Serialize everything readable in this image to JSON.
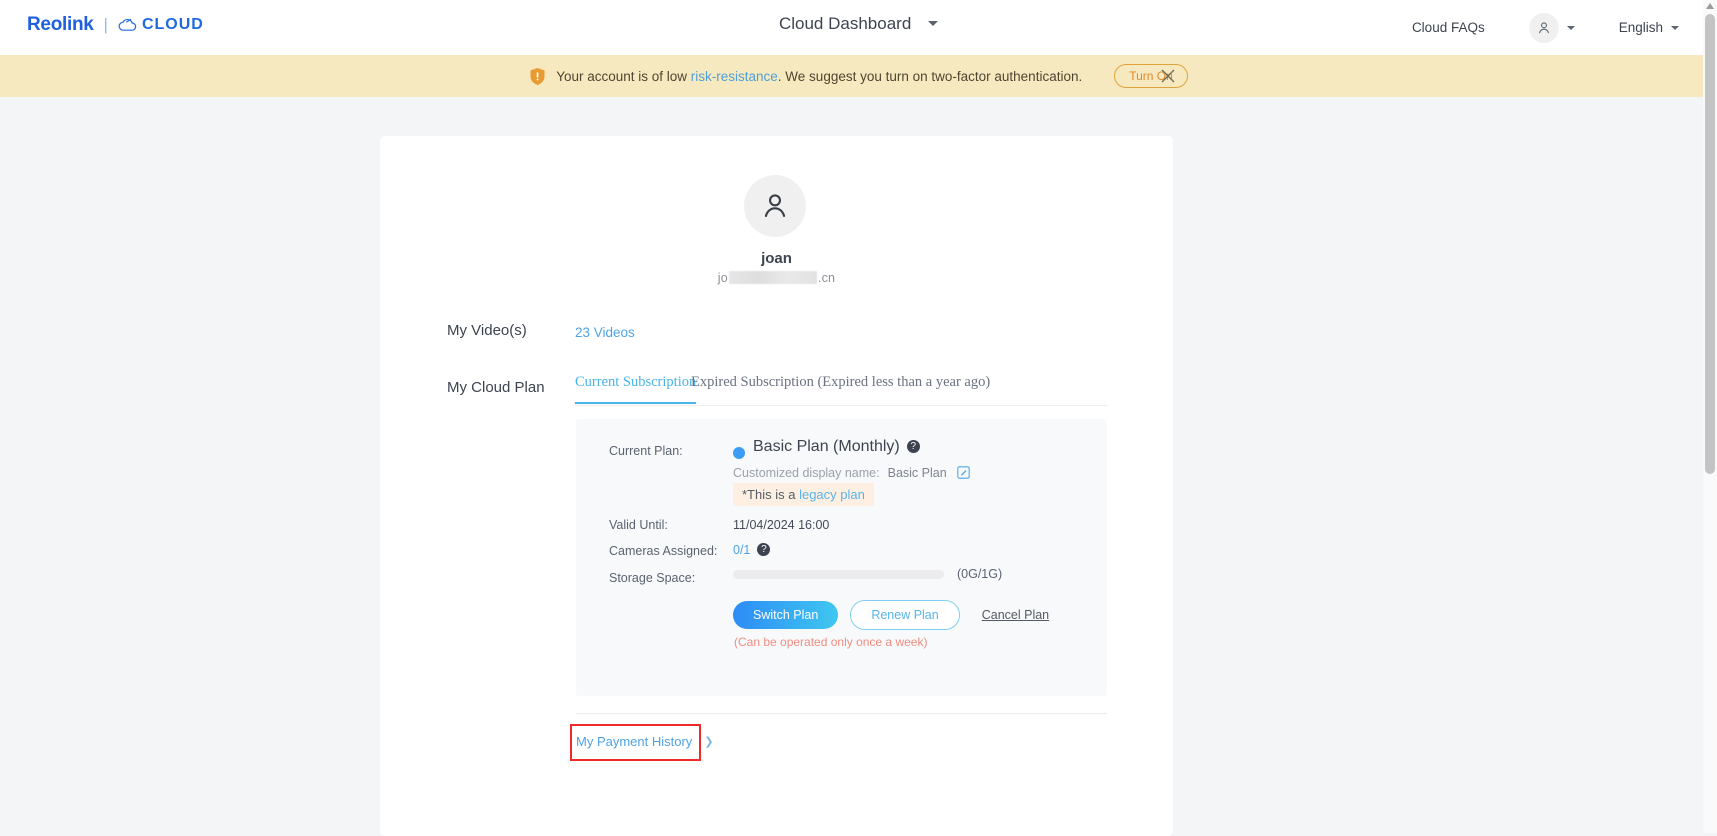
{
  "header": {
    "brand_name": "Reolink",
    "brand_separator": "|",
    "brand_cloud": "CLOUD",
    "title": "Cloud Dashboard",
    "faq_label": "Cloud FAQs",
    "language": "English",
    "avatar_icon": "user-icon",
    "title_caret_icon": "chevron-down-icon",
    "avatar_caret_icon": "chevron-down-icon",
    "language_caret_icon": "chevron-down-icon"
  },
  "notice": {
    "icon": "shield-warning-icon",
    "text_before": "Your account is of low ",
    "link_text": "risk-resistance",
    "text_after": ". We suggest you turn on two-factor authentication.",
    "button_label": "Turn On",
    "close_icon": "close-icon",
    "bg_color": "#f7e9bf",
    "link_color": "#4f9fd8",
    "button_color": "#e08a2c"
  },
  "profile": {
    "avatar_icon": "user-icon",
    "name": "joan",
    "email_prefix": "jo",
    "email_suffix": ".cn",
    "email_redacted": true
  },
  "videos": {
    "label": "My Video(s)",
    "count_label": "23 Videos",
    "link_color": "#4fa3e3"
  },
  "cloud_plan": {
    "label": "My Cloud Plan",
    "tabs": [
      {
        "label": "Current Subscription",
        "active": true
      },
      {
        "label": "Expired Subscription (Expired less than a year ago)",
        "active": false
      }
    ],
    "active_tab_color": "#4ab3e8",
    "fields": {
      "current_plan_label": "Current Plan:",
      "current_plan_value": "Basic Plan (Monthly)",
      "plan_dot_color": "#3b9bf5",
      "plan_help_icon": "question-mark-icon",
      "customized_name_label": "Customized display name:",
      "customized_name_value": "Basic Plan",
      "edit_icon": "edit-pencil-icon",
      "legacy_prefix": "*This is a ",
      "legacy_link": "legacy plan",
      "valid_until_label": "Valid Until:",
      "valid_until_value": "11/04/2024 16:00",
      "cameras_label": "Cameras Assigned:",
      "cameras_value": "0/1",
      "cameras_help_icon": "question-mark-icon",
      "storage_label": "Storage Space:",
      "storage_value": "(0G/1G)",
      "storage_percent": 0
    },
    "actions": {
      "switch_label": "Switch Plan",
      "renew_label": "Renew Plan",
      "cancel_label": "Cancel Plan",
      "note": "(Can be operated only once a week)",
      "note_color": "#ef8d80"
    },
    "payment_history": {
      "label": "My Payment History",
      "chevron_icon": "chevron-right-icon",
      "highlight_color": "#ee2b2b"
    }
  },
  "scrollbar": {
    "up_arrow_icon": "triangle-up-icon"
  }
}
